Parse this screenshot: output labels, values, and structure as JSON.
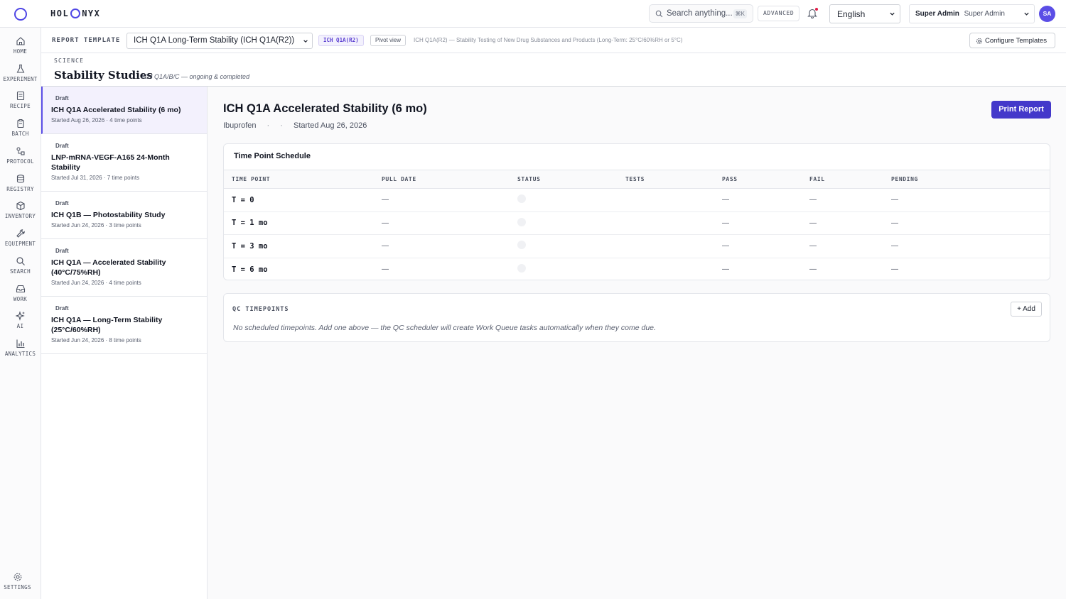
{
  "app": {
    "brand_left": "HOL",
    "brand_right": "NYX"
  },
  "topbar": {
    "search_placeholder": "Search anything...",
    "search_shortcut": "⌘K",
    "advanced_label": "ADVANCED",
    "language": "English",
    "user_role": "Super Admin",
    "user_name": "Super Admin",
    "avatar_initials": "SA"
  },
  "nav": {
    "items": [
      {
        "label": "HOME",
        "icon": "home-icon"
      },
      {
        "label": "EXPERIMENT",
        "icon": "flask-icon"
      },
      {
        "label": "RECIPE",
        "icon": "recipe-icon"
      },
      {
        "label": "BATCH",
        "icon": "batch-icon"
      },
      {
        "label": "PROTOCOL",
        "icon": "protocol-icon"
      },
      {
        "label": "REGISTRY",
        "icon": "database-icon"
      },
      {
        "label": "INVENTORY",
        "icon": "box-icon"
      },
      {
        "label": "EQUIPMENT",
        "icon": "wrench-icon"
      },
      {
        "label": "SEARCH",
        "icon": "search-icon"
      },
      {
        "label": "WORK",
        "icon": "inbox-icon"
      },
      {
        "label": "AI",
        "icon": "sparkle-icon"
      },
      {
        "label": "ANALYTICS",
        "icon": "bar-chart-icon"
      }
    ],
    "settings_label": "SETTINGS"
  },
  "template_bar": {
    "label": "REPORT TEMPLATE",
    "selected": "ICH Q1A Long-Term Stability (ICH Q1A(R2))",
    "chip_ich": "ICH Q1A(R2)",
    "chip_pivot": "Pivot view",
    "description": "ICH Q1A(R2) — Stability Testing of New Drug Substances and Products (Long-Term: 25°C/60%RH or 5°C)",
    "configure_label": "Configure Templates"
  },
  "page": {
    "eyebrow": "SCIENCE",
    "title": "Stability Studies",
    "subtitle": "ICH Q1A/B/C — ongoing & completed"
  },
  "studies": [
    {
      "status": "Draft",
      "title": "ICH Q1A Accelerated Stability (6 mo)",
      "meta": "Started Aug 26, 2026 · 4 time points"
    },
    {
      "status": "Draft",
      "title": "LNP-mRNA-VEGF-A165 24-Month Stability",
      "meta": "Started Jul 31, 2026 · 7 time points"
    },
    {
      "status": "Draft",
      "title": "ICH Q1B — Photostability Study",
      "meta": "Started Jun 24, 2026 · 3 time points"
    },
    {
      "status": "Draft",
      "title": "ICH Q1A — Accelerated Stability (40°C/75%RH)",
      "meta": "Started Jun 24, 2026 · 4 time points"
    },
    {
      "status": "Draft",
      "title": "ICH Q1A — Long-Term Stability (25°C/60%RH)",
      "meta": "Started Jun 24, 2026 · 8 time points"
    }
  ],
  "detail": {
    "title": "ICH Q1A Accelerated Stability (6 mo)",
    "product": "Ibuprofen",
    "separator": "·",
    "started": "Started Aug 26, 2026",
    "print_label": "Print Report",
    "schedule_title": "Time Point Schedule",
    "columns": [
      "TIME POINT",
      "PULL DATE",
      "STATUS",
      "TESTS",
      "PASS",
      "FAIL",
      "PENDING"
    ],
    "rows": [
      {
        "time_point": "T = 0",
        "pull_date": "—",
        "tests": "",
        "pass": "—",
        "fail": "—",
        "pending": "—"
      },
      {
        "time_point": "T = 1 mo",
        "pull_date": "—",
        "tests": "",
        "pass": "—",
        "fail": "—",
        "pending": "—"
      },
      {
        "time_point": "T = 3 mo",
        "pull_date": "—",
        "tests": "",
        "pass": "—",
        "fail": "—",
        "pending": "—"
      },
      {
        "time_point": "T = 6 mo",
        "pull_date": "—",
        "tests": "",
        "pass": "—",
        "fail": "—",
        "pending": "—"
      }
    ],
    "qc_title": "QC TIMEPOINTS",
    "qc_add_label": "+ Add",
    "qc_empty": "No scheduled timepoints. Add one above — the QC scheduler will create Work Queue tasks automatically when they come due."
  },
  "colors": {
    "accent": "#4f46e5",
    "button": "#4338ca",
    "notification": "#e11d48"
  }
}
